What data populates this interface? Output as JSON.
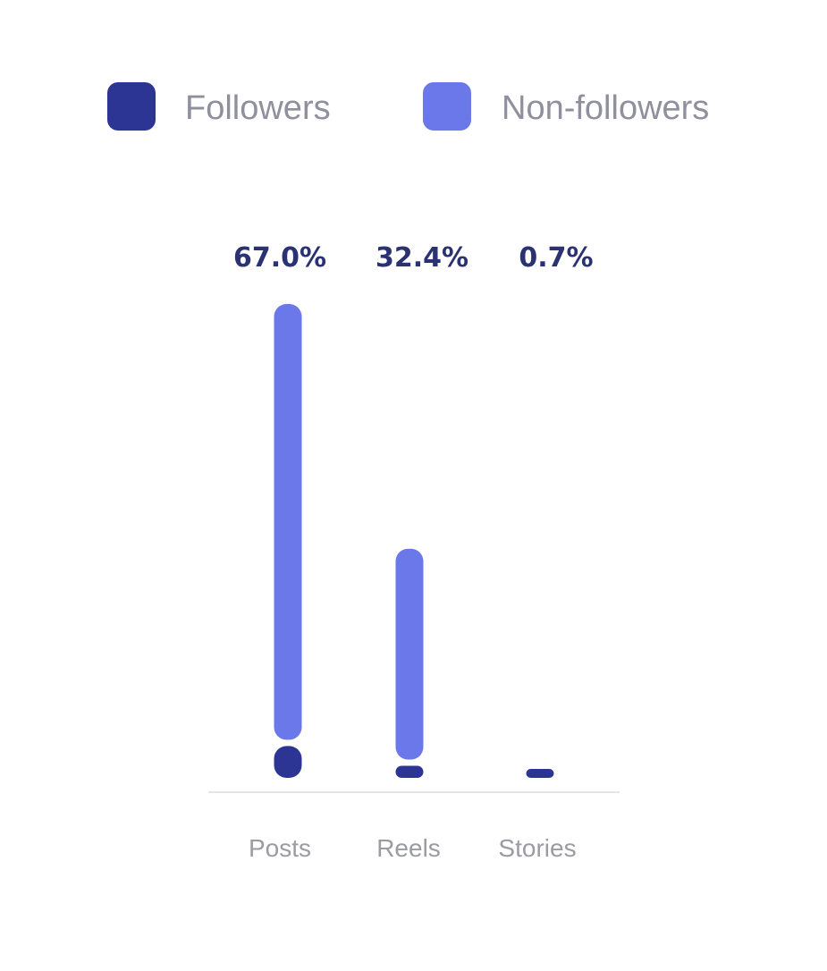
{
  "chart_data": {
    "type": "bar",
    "stacked": true,
    "categories": [
      "Posts",
      "Reels",
      "Stories"
    ],
    "totals_labels": [
      "67.0%",
      "32.4%",
      "0.7%"
    ],
    "totals": [
      67.0,
      32.4,
      0.7
    ],
    "series": [
      {
        "name": "Followers",
        "color": "#2c3593",
        "values": [
          4.5,
          1.7,
          0.7
        ]
      },
      {
        "name": "Non-followers",
        "color": "#6a78ea",
        "values": [
          62.5,
          30.7,
          0.0
        ]
      }
    ],
    "legend_position": "top",
    "grid": false,
    "ylim": [
      0,
      67.0
    ],
    "baseline_color": "#e5e5e8"
  }
}
